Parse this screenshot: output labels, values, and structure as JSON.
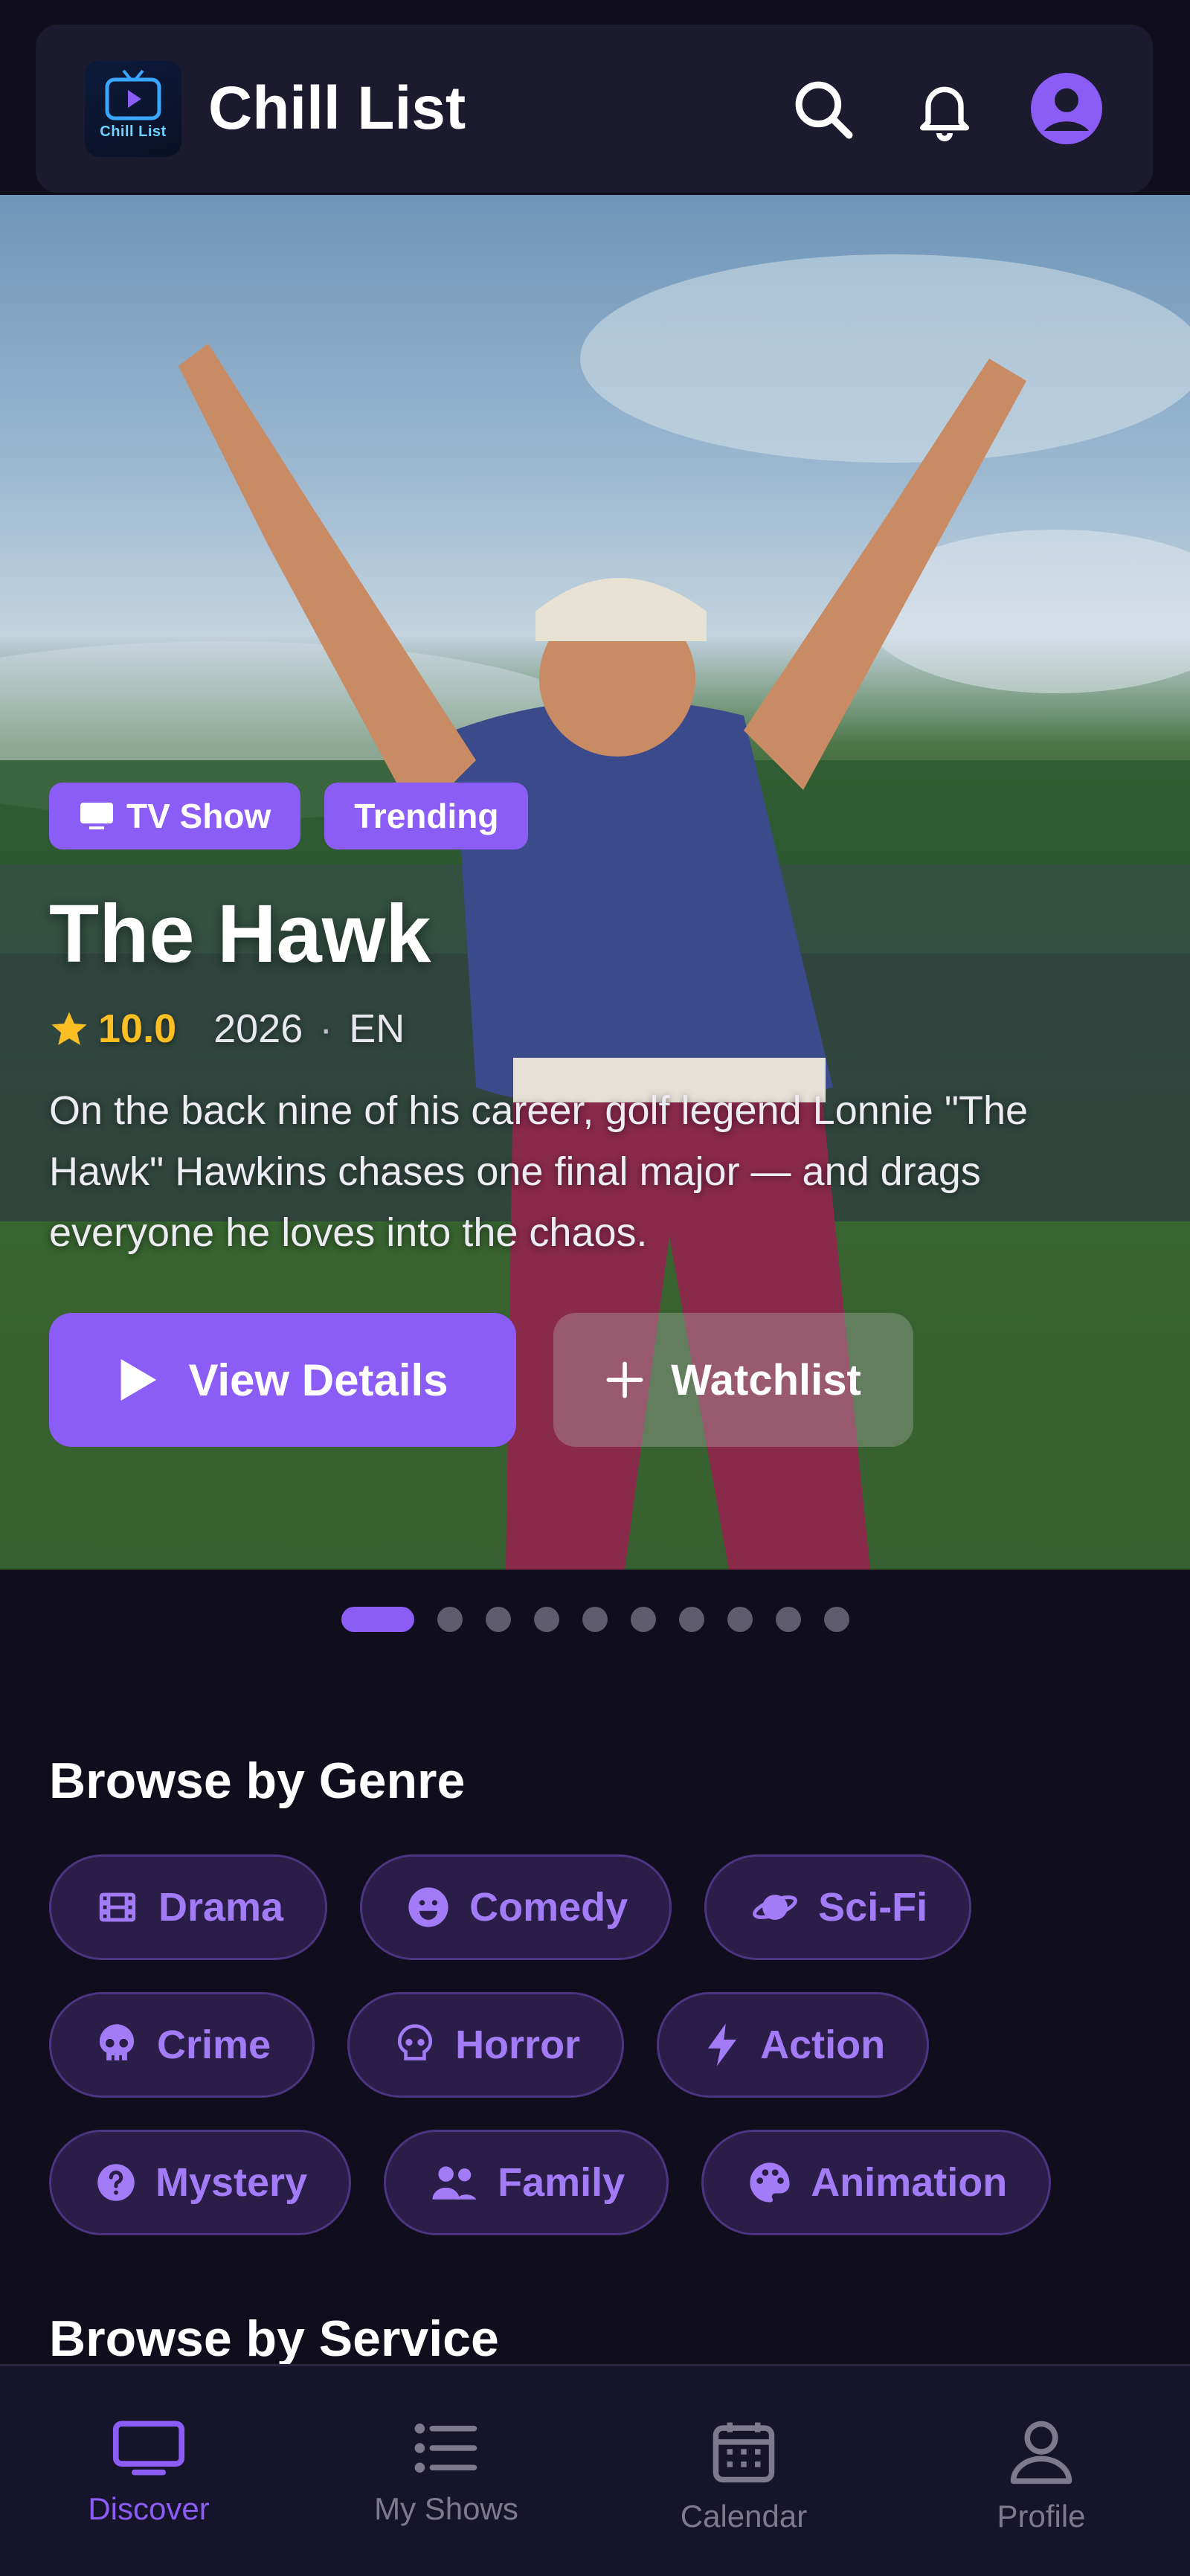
{
  "header": {
    "app_title": "Chill List",
    "logo_text": "Chill List",
    "icons": [
      "search-icon",
      "bell-icon",
      "user-avatar-icon"
    ]
  },
  "hero": {
    "badges": [
      {
        "label": "TV Show",
        "icon": "tv-icon"
      },
      {
        "label": "Trending"
      }
    ],
    "title": "The Hawk",
    "rating": "10.0",
    "year": "2026",
    "separator": "·",
    "language": "EN",
    "description": "On the back nine of his career, golf legend Lonnie \"The Hawk\" Hawkins chases one final major — and drags everyone he loves into the chaos.",
    "primary_button": "View Details",
    "secondary_button": "Watchlist",
    "carousel": {
      "total": 10,
      "active_index": 0
    }
  },
  "genres": {
    "title": "Browse by Genre",
    "items": [
      {
        "label": "Drama",
        "icon": "film-icon"
      },
      {
        "label": "Comedy",
        "icon": "smile-icon"
      },
      {
        "label": "Sci-Fi",
        "icon": "planet-icon"
      },
      {
        "label": "Crime",
        "icon": "skull-icon"
      },
      {
        "label": "Horror",
        "icon": "skull-outline-icon"
      },
      {
        "label": "Action",
        "icon": "bolt-icon"
      },
      {
        "label": "Mystery",
        "icon": "question-icon"
      },
      {
        "label": "Family",
        "icon": "people-icon"
      },
      {
        "label": "Animation",
        "icon": "palette-icon"
      }
    ]
  },
  "services": {
    "title": "Browse by Service"
  },
  "nav": {
    "items": [
      {
        "label": "Discover",
        "icon": "tv-icon",
        "active": true
      },
      {
        "label": "My Shows",
        "icon": "list-icon",
        "active": false
      },
      {
        "label": "Calendar",
        "icon": "calendar-icon",
        "active": false
      },
      {
        "label": "Profile",
        "icon": "person-icon",
        "active": false
      }
    ]
  },
  "colors": {
    "accent": "#8b5cf6",
    "background": "#100e1d",
    "header_bg": "#1c1a2e",
    "rating_star": "#fbbf24",
    "chip_bg": "#2a1d48",
    "chip_text": "#a47bf7"
  }
}
